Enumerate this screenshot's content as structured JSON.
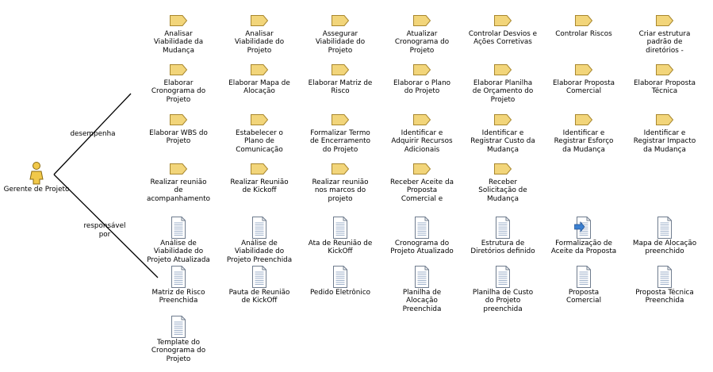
{
  "diagram": {
    "actor": {
      "label": "Gerente de Projeto",
      "icon": "person-icon"
    },
    "relations": [
      {
        "label": "desempenha"
      },
      {
        "label": "responsável\npor"
      }
    ],
    "tasks": [
      {
        "label": "Analisar\nViabilidade da\nMudança",
        "icon": "task-icon"
      },
      {
        "label": "Analisar\nViabilidade do\nProjeto",
        "icon": "task-icon"
      },
      {
        "label": "Assegurar\nViabilidade do\nProjeto",
        "icon": "task-icon"
      },
      {
        "label": "Atualizar\nCronograma do\nProjeto",
        "icon": "task-icon"
      },
      {
        "label": "Controlar Desvios e\nAções Corretivas",
        "icon": "task-icon"
      },
      {
        "label": "Controlar Riscos",
        "icon": "task-icon"
      },
      {
        "label": "Criar estrutura\npadrão de\ndiretórios -",
        "icon": "task-icon"
      },
      {
        "label": "Elaborar\nCronograma do\nProjeto",
        "icon": "task-icon"
      },
      {
        "label": "Elaborar Mapa de\nAlocação",
        "icon": "task-icon"
      },
      {
        "label": "Elaborar Matriz de\nRisco",
        "icon": "task-icon"
      },
      {
        "label": "Elaborar o Plano\ndo Projeto",
        "icon": "task-icon"
      },
      {
        "label": "Elaborar Planilha\nde Orçamento do\nProjeto",
        "icon": "task-icon"
      },
      {
        "label": "Elaborar Proposta\nComercial",
        "icon": "task-icon"
      },
      {
        "label": "Elaborar Proposta\nTécnica",
        "icon": "task-icon"
      },
      {
        "label": "Elaborar WBS do\nProjeto",
        "icon": "task-icon"
      },
      {
        "label": "Estabelecer o\nPlano de\nComunicação",
        "icon": "task-icon"
      },
      {
        "label": "Formalizar Termo\nde Encerramento\ndo Projeto",
        "icon": "task-icon"
      },
      {
        "label": "Identificar e\nAdquirir Recursos\nAdicionais",
        "icon": "task-icon"
      },
      {
        "label": "Identificar e\nRegistrar Custo da\nMudança",
        "icon": "task-icon"
      },
      {
        "label": "Identificar e\nRegistrar Esforço\nda Mudança",
        "icon": "task-icon"
      },
      {
        "label": "Identificar e\nRegistrar Impacto\nda Mudança",
        "icon": "task-icon"
      },
      {
        "label": "Realizar reunião\nde\nacompanhamento",
        "icon": "task-icon"
      },
      {
        "label": "Realizar Reunião\nde Kickoff",
        "icon": "task-icon"
      },
      {
        "label": "Realizar reunião\nnos marcos do\nprojeto",
        "icon": "task-icon"
      },
      {
        "label": "Receber Aceite da\nProposta\nComercial e",
        "icon": "task-icon"
      },
      {
        "label": "Receber\nSolicitação de\nMudança",
        "icon": "task-icon"
      }
    ],
    "artifacts": [
      {
        "label": "Análise de\nViabilidade do\nProjeto Atualizada",
        "icon": "document-icon"
      },
      {
        "label": "Análise de\nViabilidade do\nProjeto Preenchida",
        "icon": "document-icon"
      },
      {
        "label": "Ata de Reunião de\nKickOff",
        "icon": "document-icon"
      },
      {
        "label": "Cronograma do\nProjeto Atualizado",
        "icon": "document-icon"
      },
      {
        "label": "Estrutura de\nDiretórios definido",
        "icon": "document-icon"
      },
      {
        "label": "Formalização de\nAceite da Proposta",
        "icon": "document-arrow-icon"
      },
      {
        "label": "Mapa de Alocação\npreenchido",
        "icon": "document-icon"
      },
      {
        "label": "Matriz de Risco\nPreenchida",
        "icon": "document-icon"
      },
      {
        "label": "Pauta de Reunião\nde KickOff",
        "icon": "document-icon"
      },
      {
        "label": "Pedido Eletrônico",
        "icon": "document-icon"
      },
      {
        "label": "Planilha de\nAlocação\nPreenchida",
        "icon": "document-icon"
      },
      {
        "label": "Planilha de Custo\ndo Projeto\npreenchida",
        "icon": "document-icon"
      },
      {
        "label": "Proposta\nComercial",
        "icon": "document-icon"
      },
      {
        "label": "Proposta Técnica\nPreenchida",
        "icon": "document-icon"
      },
      {
        "label": "Template do\nCronograma do\nProjeto",
        "icon": "document-icon"
      }
    ]
  },
  "colors": {
    "task_fill": "#f2d57a",
    "task_stroke": "#a8872f",
    "doc_fill": "#ffffff",
    "doc_stroke": "#6f7c8e",
    "doc_lines": "#8fa4c2",
    "arrow_fill": "#3a7fd0",
    "person_fill": "#f1c84a",
    "line": "#000000"
  }
}
